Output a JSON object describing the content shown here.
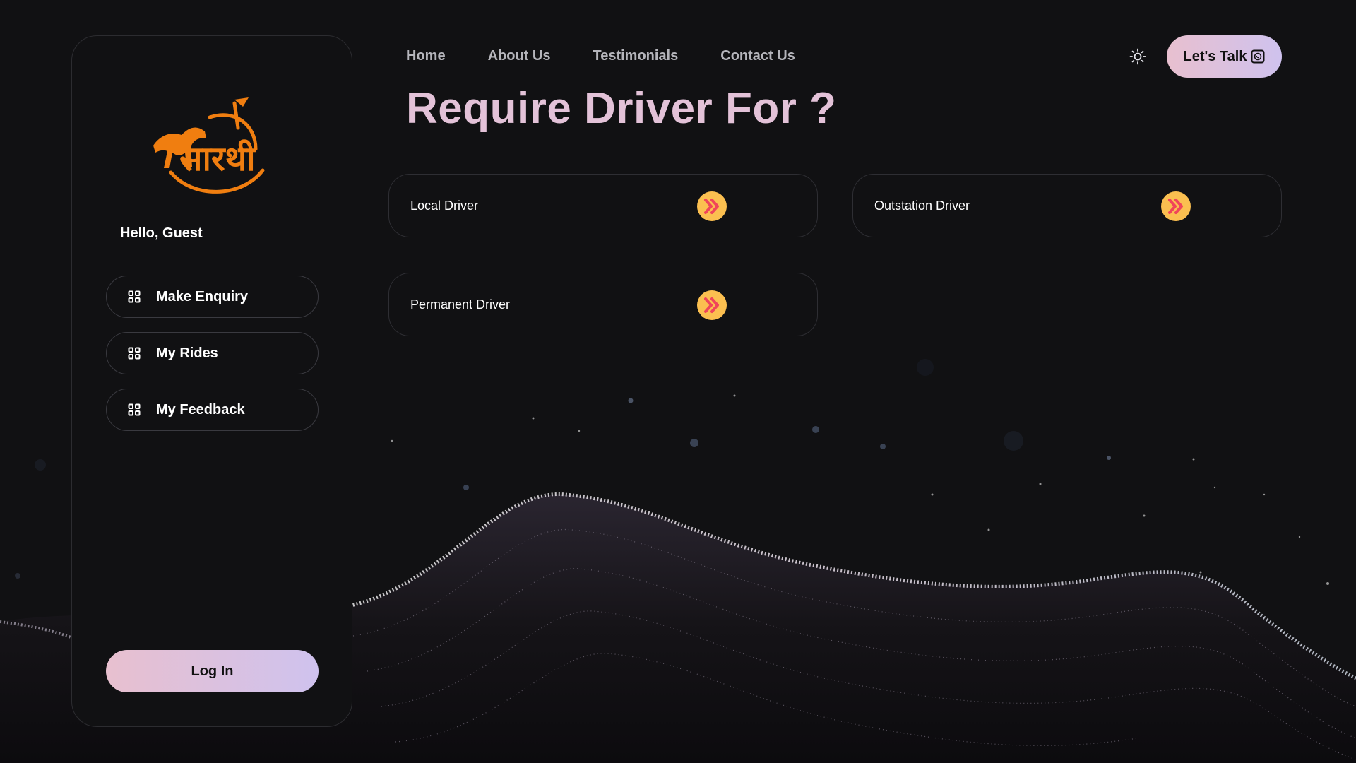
{
  "sidebar": {
    "greeting": "Hello, Guest",
    "items": [
      {
        "label": "Make Enquiry",
        "icon": "grid-icon"
      },
      {
        "label": "My Rides",
        "icon": "grid-icon"
      },
      {
        "label": "My Feedback",
        "icon": "grid-icon"
      }
    ],
    "login_label": "Log In",
    "logo": "sarthi-horse-logo"
  },
  "nav": {
    "links": [
      "Home",
      "About Us",
      "Testimonials",
      "Contact Us"
    ],
    "theme_icon": "sun-icon",
    "cta_label": "Let's Talk",
    "cta_icon": "whatsapp-icon"
  },
  "main": {
    "heading": "Require Driver For ?",
    "options": [
      {
        "label": "Local Driver",
        "icon": "double-chevron-right-icon"
      },
      {
        "label": "Outstation Driver",
        "icon": "double-chevron-right-icon"
      },
      {
        "label": "Permanent Driver",
        "icon": "double-chevron-right-icon"
      }
    ]
  },
  "colors": {
    "background": "#111113",
    "accent_gradient_start": "#e8c0cf",
    "accent_gradient_end": "#cfc2ee",
    "heading": "#e3c2d8",
    "logo": "#f07e10",
    "arrow_bg": "#fbbf50",
    "arrow_fg": "#f0455a"
  }
}
